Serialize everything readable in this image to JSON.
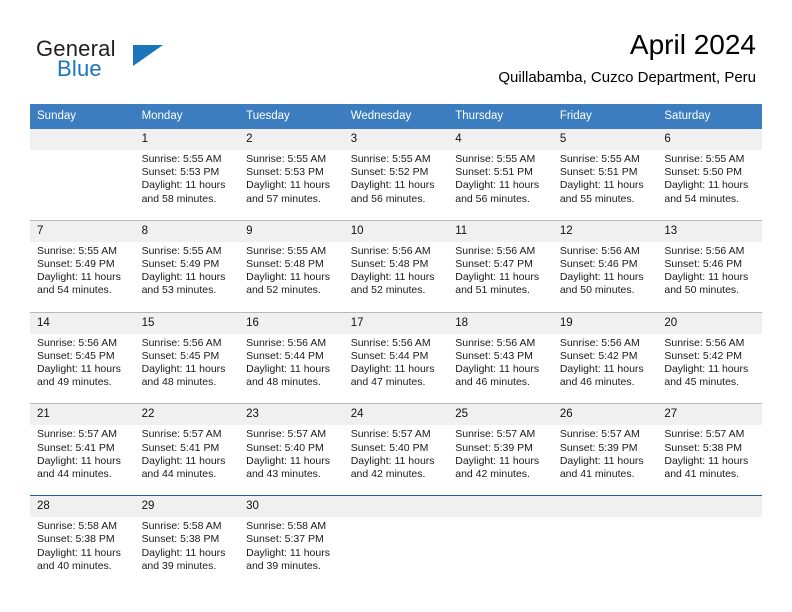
{
  "brand": {
    "part1": "General",
    "part2": "Blue",
    "triangle_color": "#1b75bb"
  },
  "header": {
    "title": "April 2024",
    "subtitle": "Quillabamba, Cuzco Department, Peru"
  },
  "colors": {
    "header_row": "#3b7dbf",
    "daynum_band": "#f0f0f0",
    "row_divider": "#b9b9b9",
    "blue_divider": "#1b62ab",
    "text": "#000000"
  },
  "weekdays": [
    "Sunday",
    "Monday",
    "Tuesday",
    "Wednesday",
    "Thursday",
    "Friday",
    "Saturday"
  ],
  "weeks": [
    {
      "divider": "none",
      "days": [
        {
          "num": "",
          "lines": []
        },
        {
          "num": "1",
          "lines": [
            "Sunrise: 5:55 AM",
            "Sunset: 5:53 PM",
            "Daylight: 11 hours",
            "and 58 minutes."
          ]
        },
        {
          "num": "2",
          "lines": [
            "Sunrise: 5:55 AM",
            "Sunset: 5:53 PM",
            "Daylight: 11 hours",
            "and 57 minutes."
          ]
        },
        {
          "num": "3",
          "lines": [
            "Sunrise: 5:55 AM",
            "Sunset: 5:52 PM",
            "Daylight: 11 hours",
            "and 56 minutes."
          ]
        },
        {
          "num": "4",
          "lines": [
            "Sunrise: 5:55 AM",
            "Sunset: 5:51 PM",
            "Daylight: 11 hours",
            "and 56 minutes."
          ]
        },
        {
          "num": "5",
          "lines": [
            "Sunrise: 5:55 AM",
            "Sunset: 5:51 PM",
            "Daylight: 11 hours",
            "and 55 minutes."
          ]
        },
        {
          "num": "6",
          "lines": [
            "Sunrise: 5:55 AM",
            "Sunset: 5:50 PM",
            "Daylight: 11 hours",
            "and 54 minutes."
          ]
        }
      ]
    },
    {
      "divider": "gray",
      "days": [
        {
          "num": "7",
          "lines": [
            "Sunrise: 5:55 AM",
            "Sunset: 5:49 PM",
            "Daylight: 11 hours",
            "and 54 minutes."
          ]
        },
        {
          "num": "8",
          "lines": [
            "Sunrise: 5:55 AM",
            "Sunset: 5:49 PM",
            "Daylight: 11 hours",
            "and 53 minutes."
          ]
        },
        {
          "num": "9",
          "lines": [
            "Sunrise: 5:55 AM",
            "Sunset: 5:48 PM",
            "Daylight: 11 hours",
            "and 52 minutes."
          ]
        },
        {
          "num": "10",
          "lines": [
            "Sunrise: 5:56 AM",
            "Sunset: 5:48 PM",
            "Daylight: 11 hours",
            "and 52 minutes."
          ]
        },
        {
          "num": "11",
          "lines": [
            "Sunrise: 5:56 AM",
            "Sunset: 5:47 PM",
            "Daylight: 11 hours",
            "and 51 minutes."
          ]
        },
        {
          "num": "12",
          "lines": [
            "Sunrise: 5:56 AM",
            "Sunset: 5:46 PM",
            "Daylight: 11 hours",
            "and 50 minutes."
          ]
        },
        {
          "num": "13",
          "lines": [
            "Sunrise: 5:56 AM",
            "Sunset: 5:46 PM",
            "Daylight: 11 hours",
            "and 50 minutes."
          ]
        }
      ]
    },
    {
      "divider": "gray",
      "days": [
        {
          "num": "14",
          "lines": [
            "Sunrise: 5:56 AM",
            "Sunset: 5:45 PM",
            "Daylight: 11 hours",
            "and 49 minutes."
          ]
        },
        {
          "num": "15",
          "lines": [
            "Sunrise: 5:56 AM",
            "Sunset: 5:45 PM",
            "Daylight: 11 hours",
            "and 48 minutes."
          ]
        },
        {
          "num": "16",
          "lines": [
            "Sunrise: 5:56 AM",
            "Sunset: 5:44 PM",
            "Daylight: 11 hours",
            "and 48 minutes."
          ]
        },
        {
          "num": "17",
          "lines": [
            "Sunrise: 5:56 AM",
            "Sunset: 5:44 PM",
            "Daylight: 11 hours",
            "and 47 minutes."
          ]
        },
        {
          "num": "18",
          "lines": [
            "Sunrise: 5:56 AM",
            "Sunset: 5:43 PM",
            "Daylight: 11 hours",
            "and 46 minutes."
          ]
        },
        {
          "num": "19",
          "lines": [
            "Sunrise: 5:56 AM",
            "Sunset: 5:42 PM",
            "Daylight: 11 hours",
            "and 46 minutes."
          ]
        },
        {
          "num": "20",
          "lines": [
            "Sunrise: 5:56 AM",
            "Sunset: 5:42 PM",
            "Daylight: 11 hours",
            "and 45 minutes."
          ]
        }
      ]
    },
    {
      "divider": "gray",
      "days": [
        {
          "num": "21",
          "lines": [
            "Sunrise: 5:57 AM",
            "Sunset: 5:41 PM",
            "Daylight: 11 hours",
            "and 44 minutes."
          ]
        },
        {
          "num": "22",
          "lines": [
            "Sunrise: 5:57 AM",
            "Sunset: 5:41 PM",
            "Daylight: 11 hours",
            "and 44 minutes."
          ]
        },
        {
          "num": "23",
          "lines": [
            "Sunrise: 5:57 AM",
            "Sunset: 5:40 PM",
            "Daylight: 11 hours",
            "and 43 minutes."
          ]
        },
        {
          "num": "24",
          "lines": [
            "Sunrise: 5:57 AM",
            "Sunset: 5:40 PM",
            "Daylight: 11 hours",
            "and 42 minutes."
          ]
        },
        {
          "num": "25",
          "lines": [
            "Sunrise: 5:57 AM",
            "Sunset: 5:39 PM",
            "Daylight: 11 hours",
            "and 42 minutes."
          ]
        },
        {
          "num": "26",
          "lines": [
            "Sunrise: 5:57 AM",
            "Sunset: 5:39 PM",
            "Daylight: 11 hours",
            "and 41 minutes."
          ]
        },
        {
          "num": "27",
          "lines": [
            "Sunrise: 5:57 AM",
            "Sunset: 5:38 PM",
            "Daylight: 11 hours",
            "and 41 minutes."
          ]
        }
      ]
    },
    {
      "divider": "blue",
      "days": [
        {
          "num": "28",
          "lines": [
            "Sunrise: 5:58 AM",
            "Sunset: 5:38 PM",
            "Daylight: 11 hours",
            "and 40 minutes."
          ]
        },
        {
          "num": "29",
          "lines": [
            "Sunrise: 5:58 AM",
            "Sunset: 5:38 PM",
            "Daylight: 11 hours",
            "and 39 minutes."
          ]
        },
        {
          "num": "30",
          "lines": [
            "Sunrise: 5:58 AM",
            "Sunset: 5:37 PM",
            "Daylight: 11 hours",
            "and 39 minutes."
          ]
        },
        {
          "num": "",
          "lines": []
        },
        {
          "num": "",
          "lines": []
        },
        {
          "num": "",
          "lines": []
        },
        {
          "num": "",
          "lines": []
        }
      ]
    }
  ]
}
